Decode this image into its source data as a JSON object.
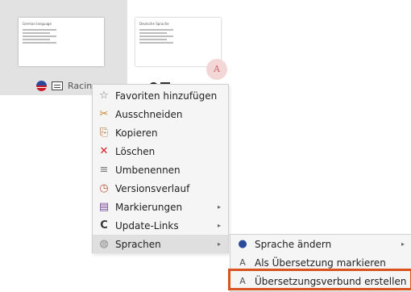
{
  "slides": [
    {
      "title": "German language",
      "bullets": [
        "Genner language",
        "Which are I lose a wrta",
        "Teilnenangebot verbande",
        "Sprache",
        "Zeugnis"
      ],
      "label": "Racing"
    },
    {
      "title": "Deutsche Sprache",
      "bullets": [
        "Deutsche Sprache",
        "Was muss ich erhalten",
        "Haben Angebot verbands",
        "Sprache dieser",
        "Fehl deutsche Sprache lt"
      ]
    }
  ],
  "translation_badge": "A",
  "context_menu": {
    "items": [
      {
        "icon": "star-outline-icon",
        "glyph": "☆",
        "color": "#777777",
        "label": "Favoriten hinzufügen",
        "has_submenu": false
      },
      {
        "icon": "scissors-icon",
        "glyph": "✂",
        "color": "#c8842a",
        "label": "Ausschneiden",
        "has_submenu": false
      },
      {
        "icon": "copy-icon",
        "glyph": "⎘",
        "color": "#b5651d",
        "label": "Kopieren",
        "has_submenu": false
      },
      {
        "icon": "delete-x-icon",
        "glyph": "✕",
        "color": "#d01f1f",
        "label": "Löschen",
        "has_submenu": false
      },
      {
        "icon": "rename-icon",
        "glyph": "≡",
        "color": "#7a7a7a",
        "label": "Umbenennen",
        "has_submenu": false
      },
      {
        "icon": "version-history-icon",
        "glyph": "◷",
        "color": "#c25a3a",
        "label": "Versionsverlauf",
        "has_submenu": false
      },
      {
        "icon": "markings-icon",
        "glyph": "▤",
        "color": "#7a4b9a",
        "label": "Markierungen",
        "has_submenu": true
      },
      {
        "icon": "update-links-icon",
        "glyph": "C",
        "color": "#333333",
        "label": "Update-Links",
        "has_submenu": true
      },
      {
        "icon": "globe-icon",
        "glyph": "◍",
        "color": "#8a8a8a",
        "label": "Sprachen",
        "has_submenu": true
      }
    ]
  },
  "submenu": {
    "items": [
      {
        "icon": "us-flag-icon",
        "glyph": "●",
        "color": "#2a4b9b",
        "label": "Sprache ändern",
        "has_submenu": true
      },
      {
        "icon": "mark-translation-icon",
        "glyph": "A",
        "color": "#555555",
        "label": "Als Übersetzung markieren",
        "has_submenu": false
      },
      {
        "icon": "translation-group-icon",
        "glyph": "A",
        "color": "#555555",
        "label": "Übersetzungsverbund erstellen",
        "has_submenu": false
      }
    ]
  },
  "submenu_arrow": "▸",
  "colors": {
    "highlight_border": "#d9531e",
    "menu_background": "#f5f5f5",
    "hover_background": "#dfdfdf",
    "selection_tile": "#e2e2e2"
  }
}
